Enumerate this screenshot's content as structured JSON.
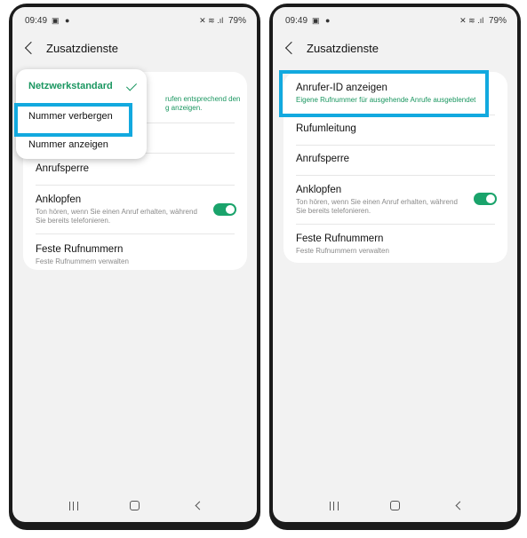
{
  "status": {
    "time": "09:49",
    "icons_left": "▣ ●",
    "icons_right": "✕ ≋ .ıl",
    "battery": "79%"
  },
  "left_screen": {
    "title": "Zusatzdienste",
    "popup": {
      "options": [
        "Netzwerkstandard",
        "Nummer verbergen",
        "Nummer anzeigen"
      ],
      "selected": "Netzwerkstandard",
      "highlighted": "Nummer verbergen"
    },
    "partial_sub_line1": "rufen entsprechend den",
    "partial_sub_line2": "g anzeigen.",
    "items": [
      {
        "title": "Anrufsperre"
      },
      {
        "title": "Anklopfen",
        "sub": "Ton hören, wenn Sie einen Anruf erhalten, während Sie bereits telefonieren.",
        "toggle": true
      },
      {
        "title": "Feste Rufnummern",
        "sub": "Feste Rufnummern verwalten"
      }
    ]
  },
  "right_screen": {
    "title": "Zusatzdienste",
    "items": [
      {
        "title": "Anrufer-ID anzeigen",
        "sub": "Eigene Rufnummer für ausgehende Anrufe ausgeblendet"
      },
      {
        "title": "Rufumleitung"
      },
      {
        "title": "Anrufsperre"
      },
      {
        "title": "Anklopfen",
        "sub": "Ton hören, wenn Sie einen Anruf erhalten, während Sie bereits telefonieren.",
        "toggle": true
      },
      {
        "title": "Feste Rufnummern",
        "sub": "Feste Rufnummern verwalten"
      }
    ]
  },
  "colors": {
    "highlight": "#12a9df",
    "accent_green": "#1a9660",
    "toggle_on": "#1aa36b"
  }
}
